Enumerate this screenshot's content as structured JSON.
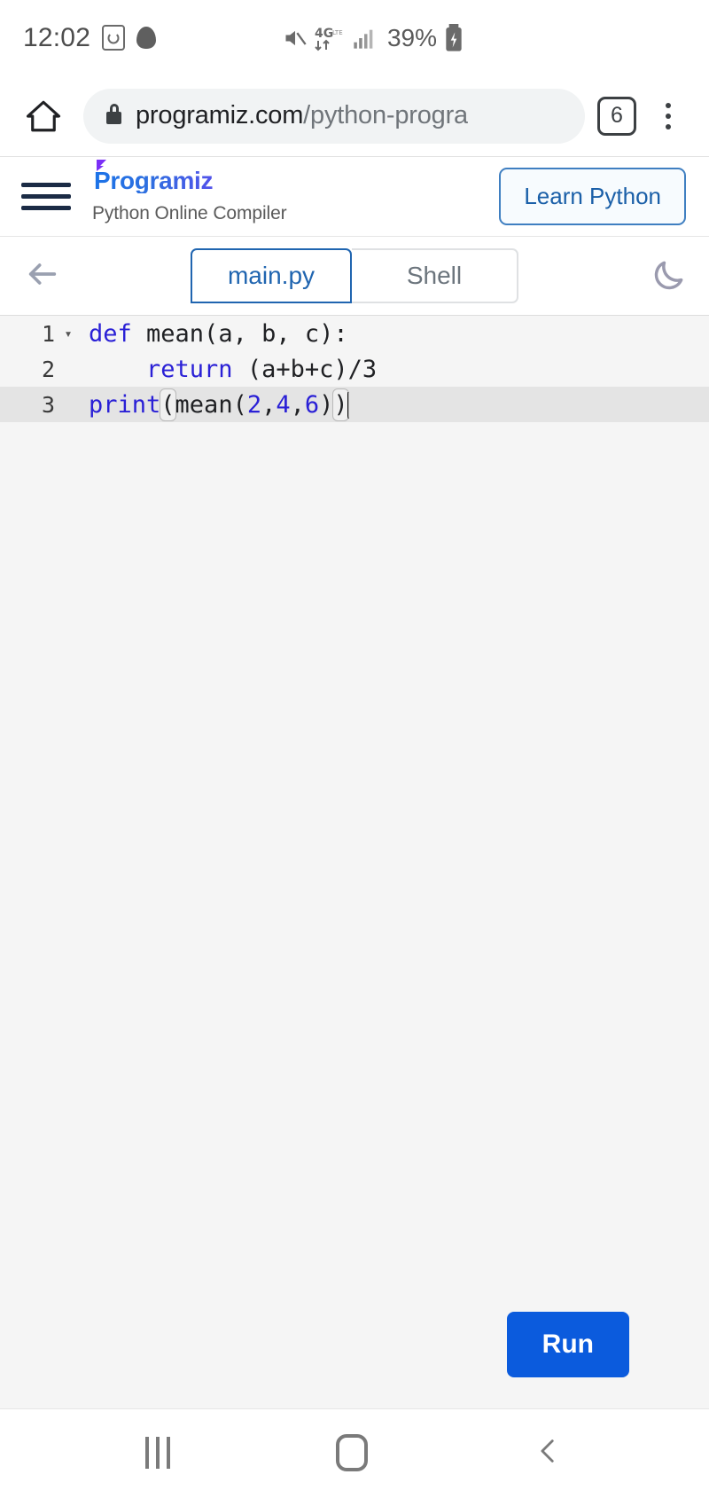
{
  "status_bar": {
    "time": "12:02",
    "battery_percent": "39%",
    "network": "4G",
    "icons": [
      "alarm-icon",
      "snapchat-icon",
      "mute-icon",
      "network-4g-icon",
      "signal-bars-icon",
      "battery-charging-icon"
    ]
  },
  "browser": {
    "home_icon": "home-icon",
    "lock_icon": "lock-icon",
    "url_domain": "programiz.com",
    "url_path": "/python-progra",
    "tab_count": "6",
    "menu_icon": "overflow-menu-icon"
  },
  "site_header": {
    "menu_icon": "hamburger-menu-icon",
    "logo_text": "Programiz",
    "subtitle": "Python Online Compiler",
    "cta_label": "Learn Python",
    "cta_color": "#1a5fa8"
  },
  "editor_tabs": {
    "back_icon": "back-arrow-icon",
    "tabs": [
      {
        "label": "main.py",
        "active": true
      },
      {
        "label": "Shell",
        "active": false
      }
    ],
    "theme_toggle_icon": "moon-icon",
    "active_color": "#2065b0",
    "inactive_color": "#6c757d"
  },
  "code": {
    "lines": [
      {
        "number": "1",
        "foldable": true
      },
      {
        "number": "2",
        "foldable": false
      },
      {
        "number": "3",
        "foldable": false
      }
    ],
    "line1": {
      "keyword": "def",
      "rest": " mean(a, b, c):"
    },
    "line2": {
      "indent": "    ",
      "keyword": "return",
      "rest": " (a+b+c)/3"
    },
    "line3": {
      "fn": "print",
      "open_paren": "(",
      "call": "mean(",
      "args": [
        "2",
        ",",
        "4",
        ",",
        "6"
      ],
      "close_inner": ")",
      "close_paren": ")"
    },
    "current_line": "3"
  },
  "run_button": {
    "label": "Run",
    "color": "#0b5bdd"
  },
  "nav_bar": {
    "recents_icon": "recents-icon",
    "home_icon": "home-nav-icon",
    "back_icon": "back-nav-icon"
  }
}
